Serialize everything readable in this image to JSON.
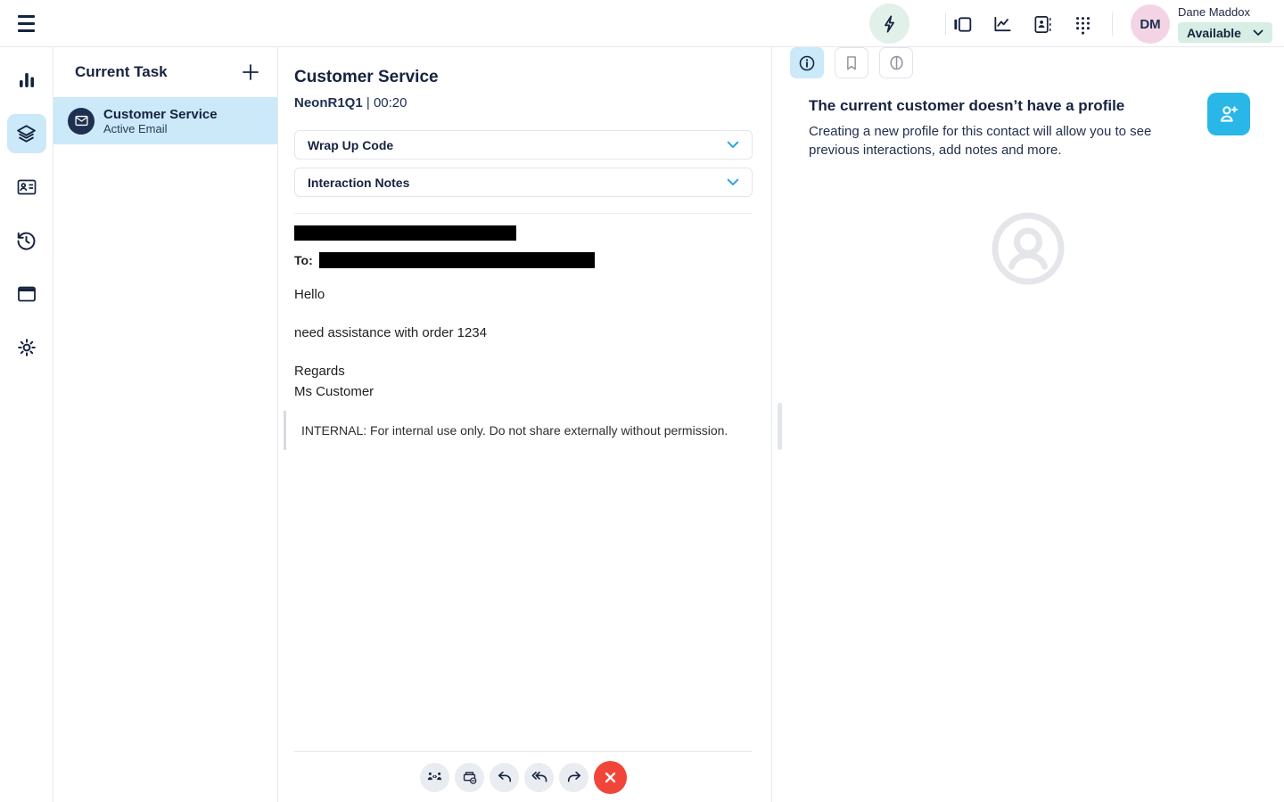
{
  "colors": {
    "navy": "#16233f",
    "accent_cyan": "#29b7e8",
    "active_light_blue": "#cbe9f8",
    "status_pill_green": "#d6eee3",
    "avatar_pink": "#f3d4e4",
    "end_red": "#f2453a",
    "lightning_bg": "#e1f0e9"
  },
  "topbar": {
    "menu_icon": "hamburger-icon",
    "quick_action_icon": "lightning-icon",
    "nav_icons": [
      "panels-icon",
      "performance-icon",
      "contacts-icon",
      "dialpad-icon"
    ],
    "user": {
      "initials": "DM",
      "name": "Dane Maddox",
      "status": "Available"
    }
  },
  "sidebar": {
    "items": [
      {
        "icon": "bar-chart-icon",
        "active": false
      },
      {
        "icon": "layers-icon",
        "active": true
      },
      {
        "icon": "contact-card-icon",
        "active": false
      },
      {
        "icon": "history-icon",
        "active": false
      },
      {
        "icon": "window-icon",
        "active": false
      },
      {
        "icon": "settings-gear-icon",
        "active": false
      }
    ]
  },
  "task_panel": {
    "title": "Current Task",
    "add_icon": "plus-icon",
    "task": {
      "title": "Customer Service",
      "subtitle": "Active Email",
      "icon": "email-icon"
    }
  },
  "interaction_panel": {
    "title": "Customer Service",
    "queue": "NeonR1Q1",
    "separator": "|",
    "timer": "00:20",
    "accordions": [
      {
        "label": "Wrap Up Code"
      },
      {
        "label": "Interaction Notes"
      }
    ],
    "email": {
      "to_label": "To:",
      "greeting": "Hello",
      "request": "need assistance with order 1234",
      "signoff": "Regards",
      "signature": "Ms Customer",
      "internal_note": "INTERNAL: For internal use only. Do not share externally without permission."
    },
    "toolbar_icons": [
      "transfer-icon",
      "park-email-icon",
      "reply-icon",
      "reply-all-icon",
      "forward-icon",
      "end-interaction-icon"
    ]
  },
  "profile_panel": {
    "tabs": [
      {
        "icon": "info-icon",
        "active": true
      },
      {
        "icon": "bookmark-icon",
        "active": false
      },
      {
        "icon": "journey-icon",
        "active": false
      }
    ],
    "heading": "The current customer doesn’t have a profile",
    "description": "Creating a new profile for this contact will allow you to see previous interactions, add notes and more.",
    "create_button_icon": "add-person-icon",
    "placeholder_icon": "profile-placeholder-icon"
  }
}
